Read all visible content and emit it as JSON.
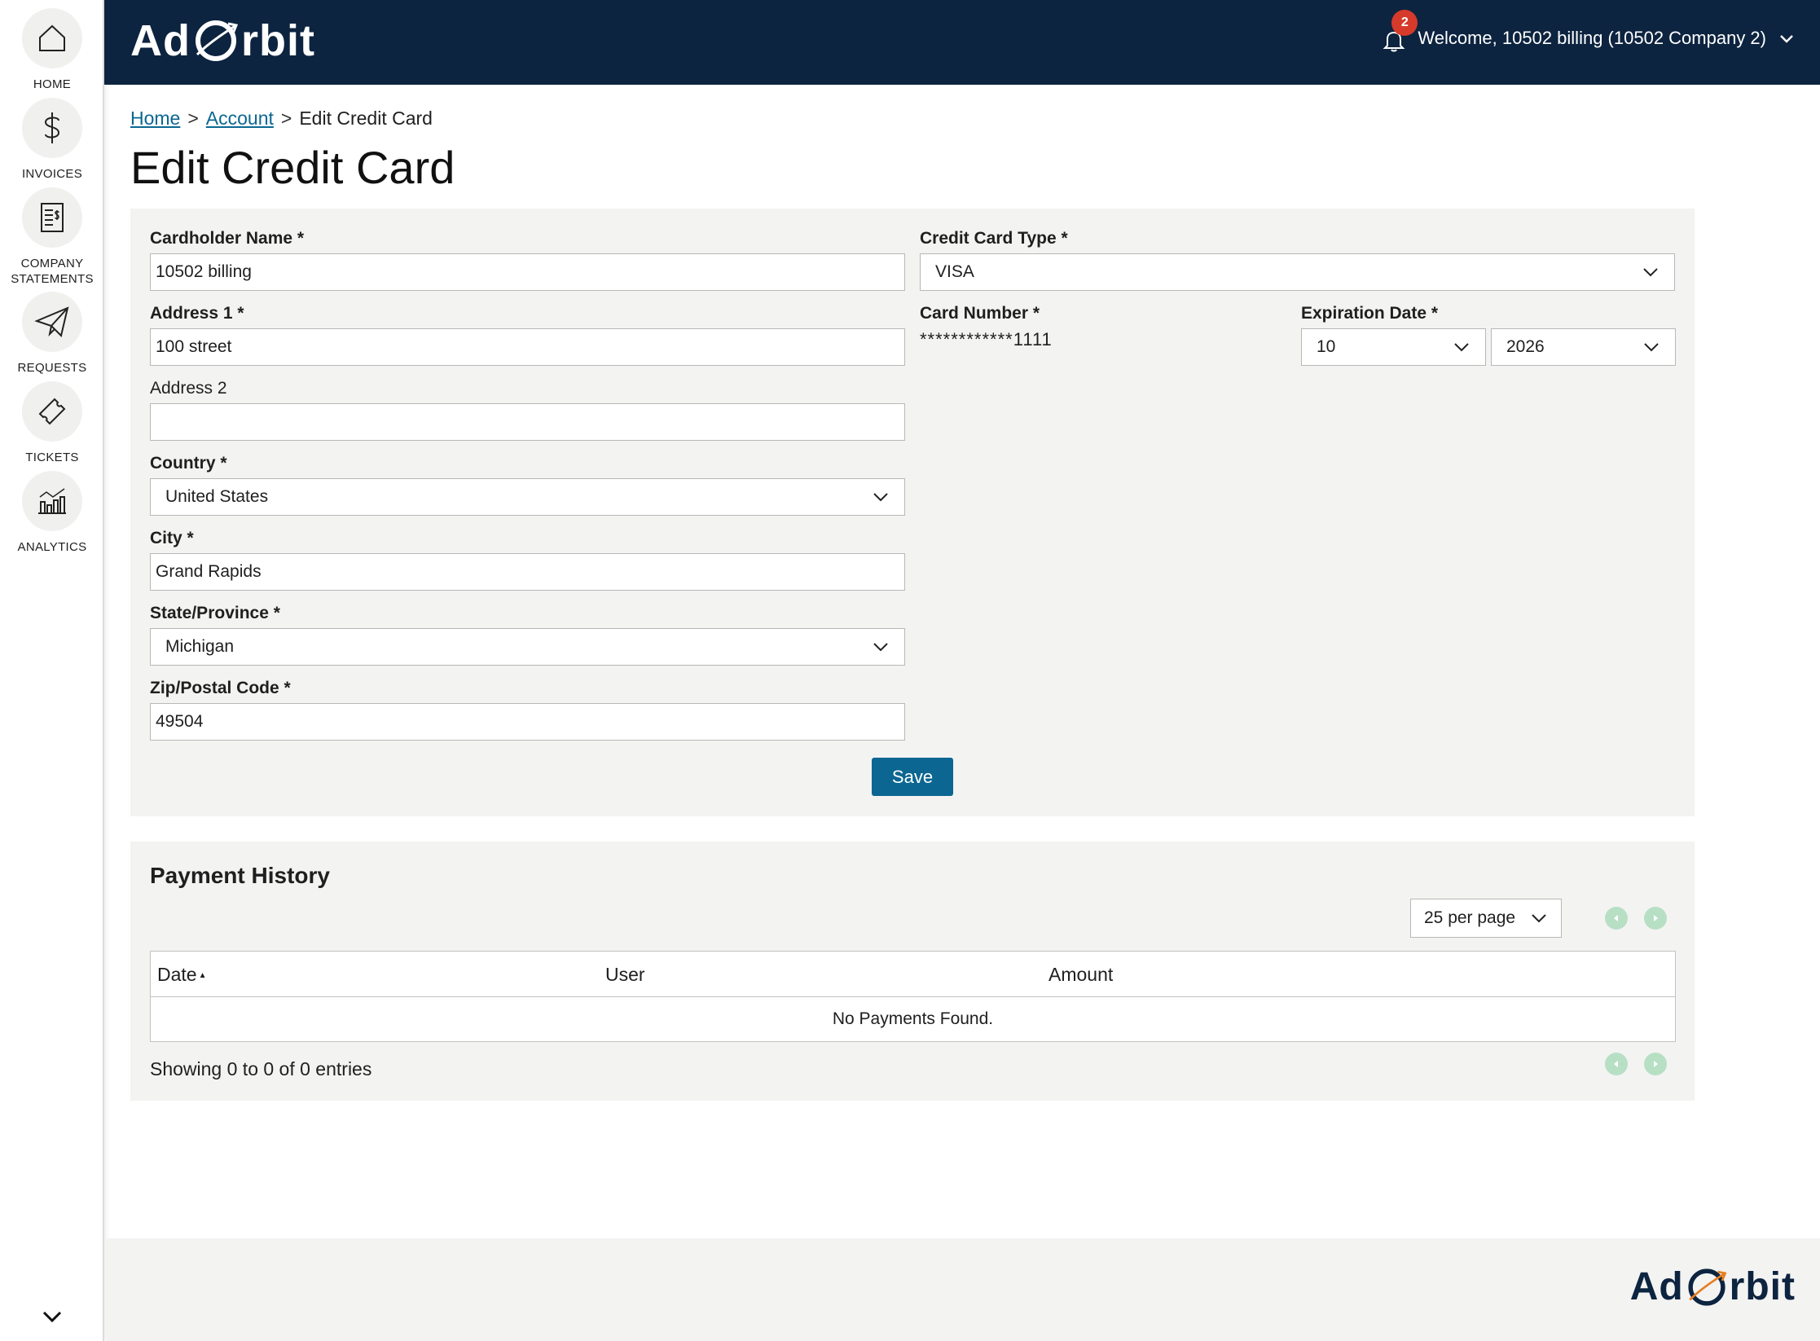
{
  "sidebar": {
    "items": [
      {
        "label": "HOME",
        "icon": "home-icon"
      },
      {
        "label": "INVOICES",
        "icon": "dollar-icon"
      },
      {
        "label": "COMPANY",
        "label2": "STATEMENTS",
        "icon": "statement-icon"
      },
      {
        "label": "REQUESTS",
        "icon": "paper-plane-icon"
      },
      {
        "label": "TICKETS",
        "icon": "ticket-icon"
      },
      {
        "label": "ANALYTICS",
        "icon": "chart-icon"
      }
    ]
  },
  "header": {
    "logo_left": "Ad",
    "logo_right": "rbit",
    "notification_count": "2",
    "welcome": "Welcome, 10502 billing (10502 Company 2)"
  },
  "breadcrumb": {
    "home": "Home",
    "account": "Account",
    "current": "Edit Credit Card",
    "separator": ">"
  },
  "page": {
    "title": "Edit Credit Card"
  },
  "form": {
    "cardholder_label": "Cardholder Name *",
    "cardholder_value": "10502 billing",
    "address1_label": "Address 1 *",
    "address1_value": "100 street",
    "address2_label": "Address 2",
    "address2_value": "",
    "country_label": "Country *",
    "country_value": "United States",
    "city_label": "City *",
    "city_value": "Grand Rapids",
    "state_label": "State/Province *",
    "state_value": "Michigan",
    "zip_label": "Zip/Postal Code *",
    "zip_value": "49504",
    "card_type_label": "Credit Card Type *",
    "card_type_value": "VISA",
    "card_number_label": "Card Number *",
    "card_number_value": "************1111",
    "expiration_label": "Expiration Date *",
    "exp_month_value": "10",
    "exp_year_value": "2026",
    "save_label": "Save"
  },
  "payment_history": {
    "title": "Payment History",
    "per_page": "25 per page",
    "columns": [
      "Date",
      "User",
      "Amount"
    ],
    "empty_message": "No Payments Found.",
    "entries_info": "Showing 0 to 0 of 0 entries"
  },
  "colors": {
    "header_bg": "#0d2440",
    "accent": "#0b6791",
    "badge": "#d63a2b",
    "logo_orbit": "#e67e22"
  }
}
